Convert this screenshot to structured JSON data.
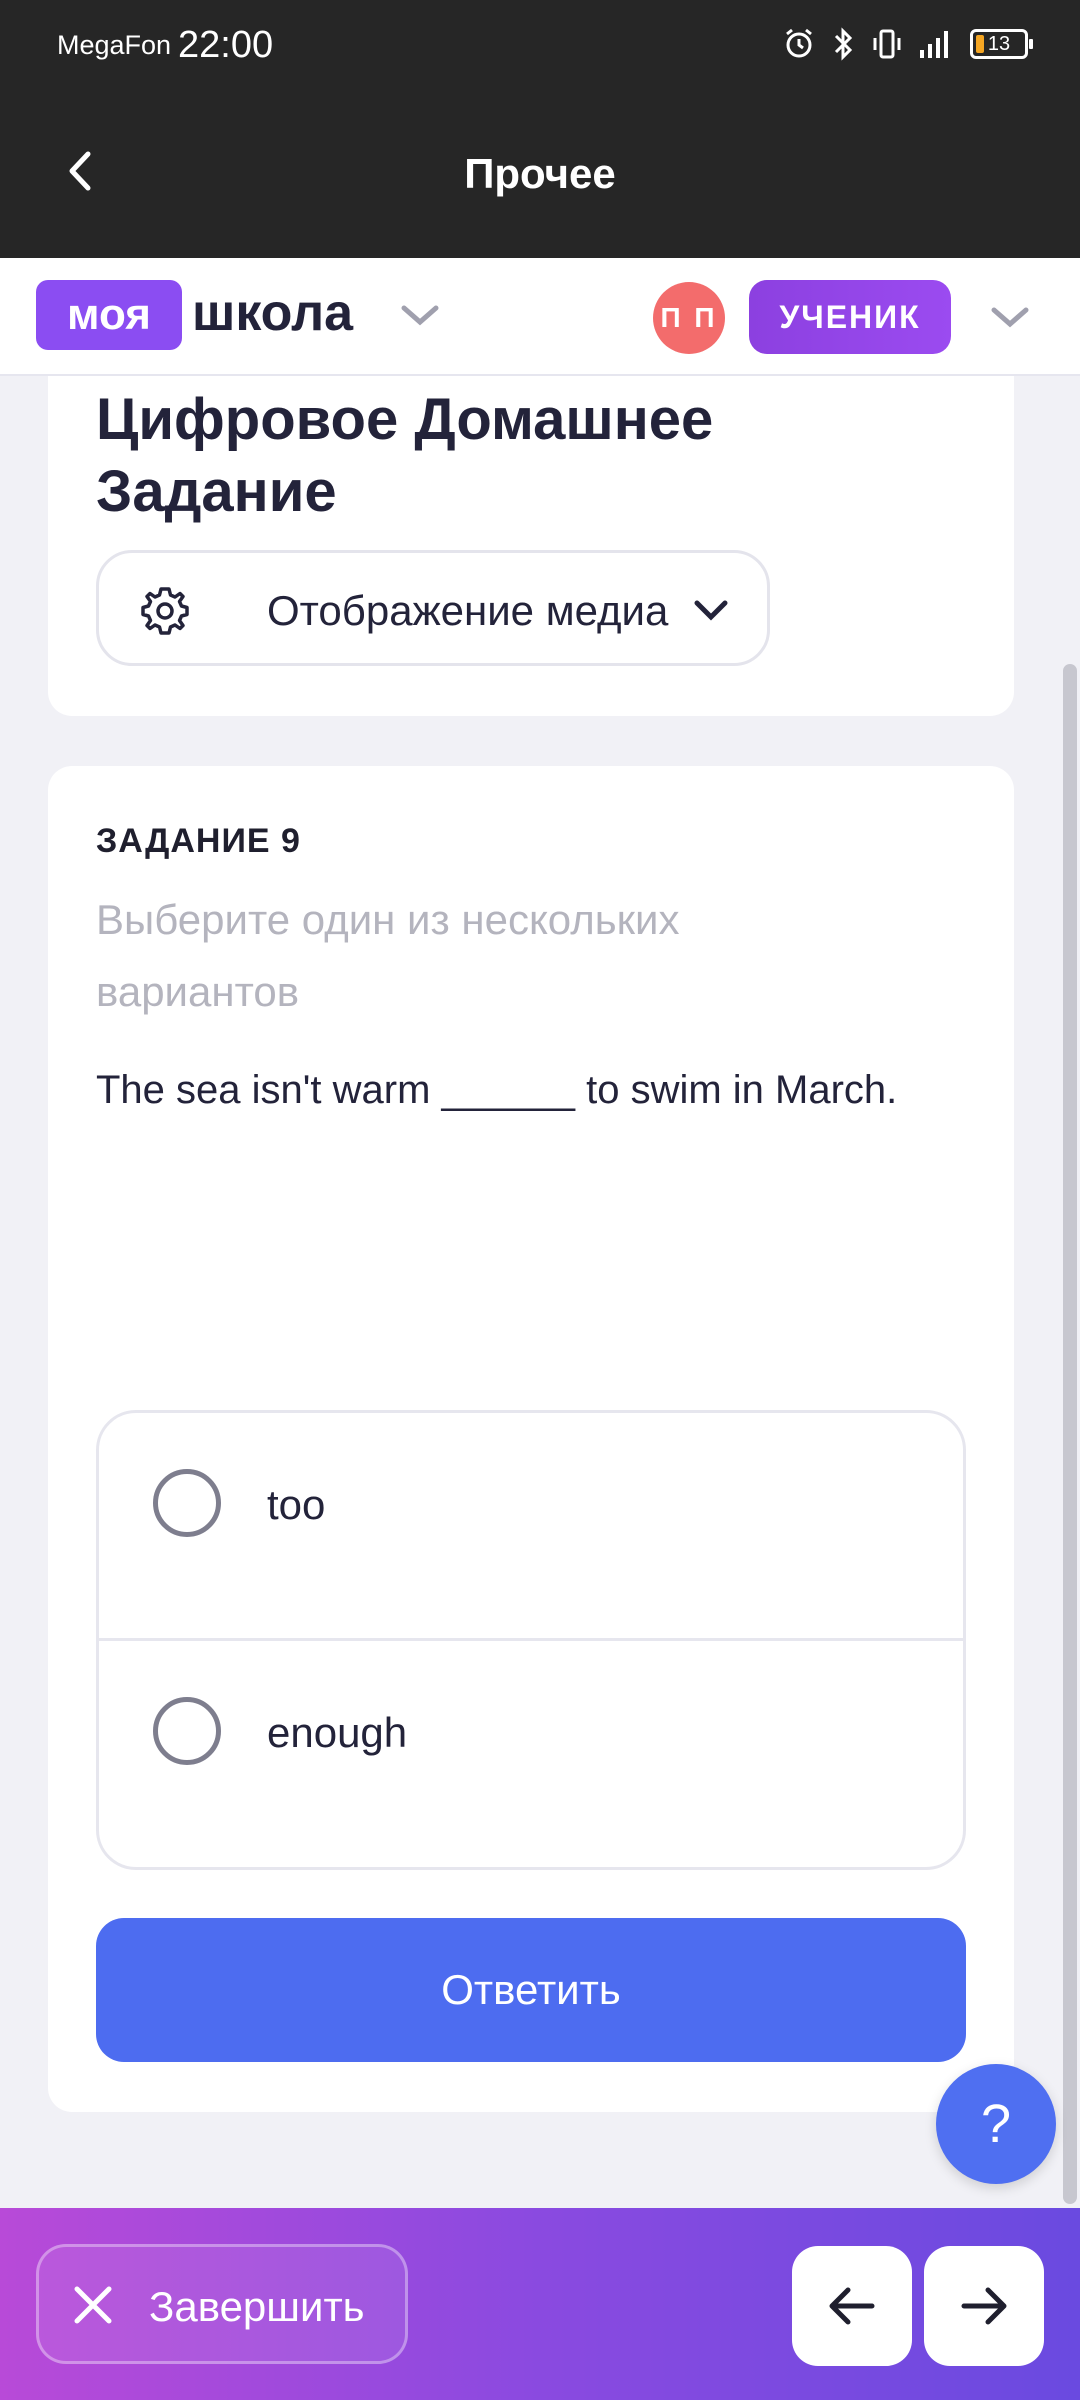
{
  "status_bar": {
    "carrier": "MegaFon",
    "time": "22:00",
    "battery": "13",
    "icons": [
      "alarm-icon",
      "bluetooth-icon",
      "vibrate-icon",
      "signal-icon"
    ]
  },
  "app_bar": {
    "title": "Прочее",
    "back_icon": "chevron-left-icon"
  },
  "header": {
    "logo_badge": "моя",
    "logo_text": "школа",
    "avatar_initials": "П П",
    "role": "УЧЕНИК"
  },
  "page": {
    "title": "Цифровое Домашнее Задание",
    "media_button": "Отображение медиа"
  },
  "task": {
    "number_label": "ЗАДАНИЕ 9",
    "hint": "Выберите один из нескольких вариантов",
    "question": "The sea isn't warm ______ to swim in March.",
    "options": [
      {
        "label": "too",
        "selected": false
      },
      {
        "label": "enough",
        "selected": false
      }
    ],
    "answer_button": "Ответить"
  },
  "help_button": "?",
  "bottom_bar": {
    "finish_label": "Завершить",
    "prev_icon": "arrow-left-icon",
    "next_icon": "arrow-right-icon"
  },
  "colors": {
    "accent_blue": "#4d6cf0",
    "brand_purple": "#8b4df2",
    "avatar_red": "#f36c6c",
    "dark_bar": "#262626"
  }
}
